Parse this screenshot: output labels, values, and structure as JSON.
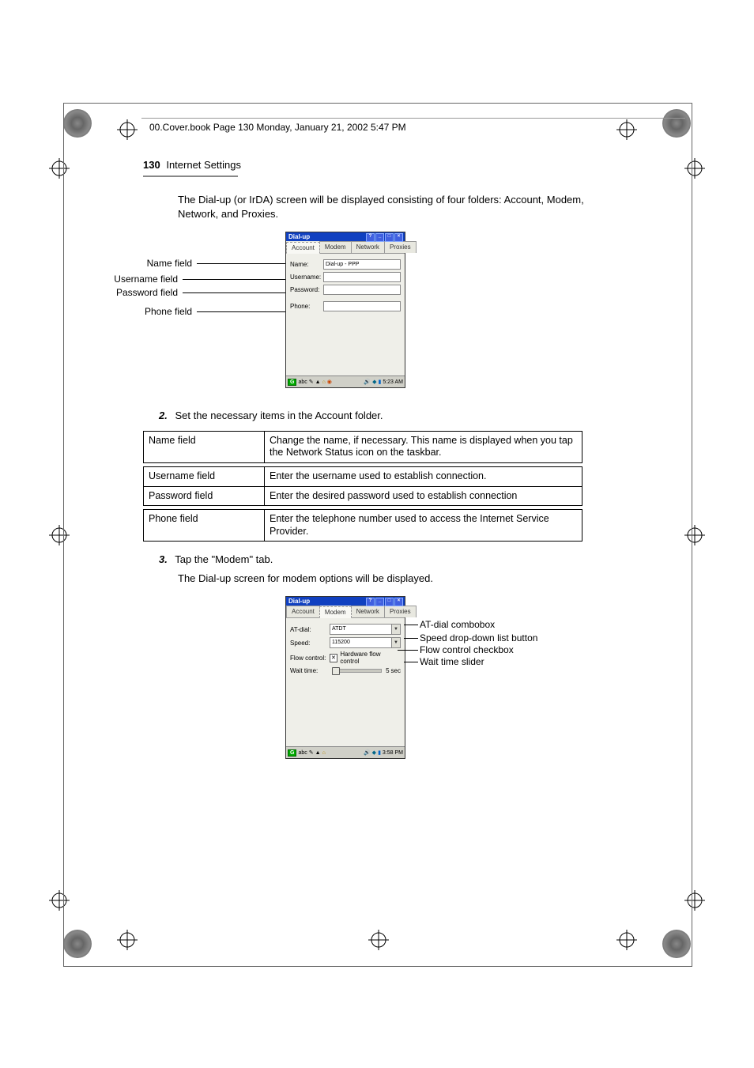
{
  "running_header": "00.Cover.book  Page 130  Monday, January 21, 2002  5:47 PM",
  "page_number": "130",
  "section_title": "Internet Settings",
  "intro_para": "The Dial-up (or IrDA) screen will be displayed consisting of four folders: Account, Modem, Network, and Proxies.",
  "callouts1": {
    "name": "Name field",
    "username": "Username field",
    "password": "Password  field",
    "phone": "Phone field"
  },
  "device1": {
    "title": "Dial-up",
    "tabs": {
      "account": "Account",
      "modem": "Modem",
      "network": "Network",
      "proxies": "Proxies"
    },
    "labels": {
      "name": "Name:",
      "username": "Username:",
      "password": "Password:",
      "phone": "Phone:"
    },
    "name_value": "Dial-up - PPP",
    "taskbar_time": "5:23 AM"
  },
  "step2_num": "2.",
  "step2_text": "Set the necessary items in the Account folder.",
  "table": {
    "r1": {
      "label": "Name field",
      "desc": "Change the name, if necessary. This name is displayed when you tap the Network Status icon on the taskbar."
    },
    "r2": {
      "label": "Username field",
      "desc": "Enter the username used to establish connection."
    },
    "r3": {
      "label": "Password field",
      "desc": "Enter the desired password used to establish connection"
    },
    "r4": {
      "label": "Phone field",
      "desc": "Enter the telephone number used to access the Internet Service Provider."
    }
  },
  "step3_num": "3.",
  "step3_text": "Tap the \"Modem\" tab.",
  "step3_body": "The Dial-up screen for modem options will be displayed.",
  "device2": {
    "title": "Dial-up",
    "tabs": {
      "account": "Account",
      "modem": "Modem",
      "network": "Network",
      "proxies": "Proxies"
    },
    "labels": {
      "atdial": "AT-dial:",
      "speed": "Speed:",
      "flow": "Flow control:",
      "wait": "Wait time:"
    },
    "atdial_value": "ATDT",
    "speed_value": "115200",
    "flow_label": "Hardware flow control",
    "wait_value": "5",
    "wait_unit": "sec",
    "taskbar_time": "3:58 PM"
  },
  "callouts2": {
    "atdial": "AT-dial combobox",
    "speed": "Speed drop-down list button",
    "flow": "Flow control checkbox",
    "wait": "Wait time slider"
  }
}
